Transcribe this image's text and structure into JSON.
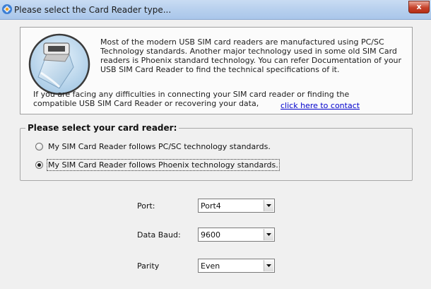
{
  "window": {
    "title": "Please select the Card Reader type...",
    "close_label": "x"
  },
  "info": {
    "paragraph": "Most of the modern USB SIM card readers are manufactured using PC/SC Technology standards. Another major technology used in some old SIM Card readers is Phoenix standard technology. You can refer Documentation of your USB SIM Card Reader to find the technical specifications of it.",
    "contact_text": "If you are facing any difficulties in connecting your SIM card reader or finding the compatible USB SIM Card Reader or recovering your data,",
    "contact_link": "click here to contact"
  },
  "reader_group": {
    "title": "Please select your card reader:",
    "options": [
      {
        "label": "My SIM Card Reader follows PC/SC technology standards.",
        "selected": false
      },
      {
        "label": "My SIM Card Reader follows Phoenix technology standards.",
        "selected": true
      }
    ]
  },
  "fields": {
    "port": {
      "label": "Port:",
      "value": "Port4"
    },
    "baud": {
      "label": "Data Baud:",
      "value": "9600"
    },
    "parity": {
      "label": "Parity",
      "value": "Even"
    }
  },
  "icons": {
    "app": "app-icon",
    "illustration": "usb-card-reader-icon",
    "close": "close-icon",
    "dropdown": "chevron-down-icon"
  },
  "colors": {
    "titlebar": "#b9d1ee",
    "close": "#c7432c",
    "link": "#0000cc",
    "window_bg": "#f0f0f0"
  }
}
